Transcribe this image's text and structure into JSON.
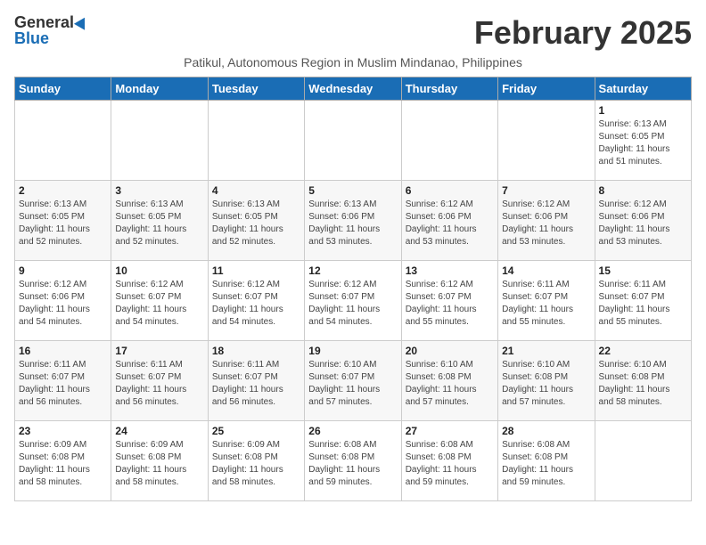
{
  "logo": {
    "general": "General",
    "blue": "Blue"
  },
  "title": "February 2025",
  "subtitle": "Patikul, Autonomous Region in Muslim Mindanao, Philippines",
  "days_of_week": [
    "Sunday",
    "Monday",
    "Tuesday",
    "Wednesday",
    "Thursday",
    "Friday",
    "Saturday"
  ],
  "weeks": [
    [
      {
        "day": "",
        "info": ""
      },
      {
        "day": "",
        "info": ""
      },
      {
        "day": "",
        "info": ""
      },
      {
        "day": "",
        "info": ""
      },
      {
        "day": "",
        "info": ""
      },
      {
        "day": "",
        "info": ""
      },
      {
        "day": "1",
        "info": "Sunrise: 6:13 AM\nSunset: 6:05 PM\nDaylight: 11 hours\nand 51 minutes."
      }
    ],
    [
      {
        "day": "2",
        "info": "Sunrise: 6:13 AM\nSunset: 6:05 PM\nDaylight: 11 hours\nand 52 minutes."
      },
      {
        "day": "3",
        "info": "Sunrise: 6:13 AM\nSunset: 6:05 PM\nDaylight: 11 hours\nand 52 minutes."
      },
      {
        "day": "4",
        "info": "Sunrise: 6:13 AM\nSunset: 6:05 PM\nDaylight: 11 hours\nand 52 minutes."
      },
      {
        "day": "5",
        "info": "Sunrise: 6:13 AM\nSunset: 6:06 PM\nDaylight: 11 hours\nand 53 minutes."
      },
      {
        "day": "6",
        "info": "Sunrise: 6:12 AM\nSunset: 6:06 PM\nDaylight: 11 hours\nand 53 minutes."
      },
      {
        "day": "7",
        "info": "Sunrise: 6:12 AM\nSunset: 6:06 PM\nDaylight: 11 hours\nand 53 minutes."
      },
      {
        "day": "8",
        "info": "Sunrise: 6:12 AM\nSunset: 6:06 PM\nDaylight: 11 hours\nand 53 minutes."
      }
    ],
    [
      {
        "day": "9",
        "info": "Sunrise: 6:12 AM\nSunset: 6:06 PM\nDaylight: 11 hours\nand 54 minutes."
      },
      {
        "day": "10",
        "info": "Sunrise: 6:12 AM\nSunset: 6:07 PM\nDaylight: 11 hours\nand 54 minutes."
      },
      {
        "day": "11",
        "info": "Sunrise: 6:12 AM\nSunset: 6:07 PM\nDaylight: 11 hours\nand 54 minutes."
      },
      {
        "day": "12",
        "info": "Sunrise: 6:12 AM\nSunset: 6:07 PM\nDaylight: 11 hours\nand 54 minutes."
      },
      {
        "day": "13",
        "info": "Sunrise: 6:12 AM\nSunset: 6:07 PM\nDaylight: 11 hours\nand 55 minutes."
      },
      {
        "day": "14",
        "info": "Sunrise: 6:11 AM\nSunset: 6:07 PM\nDaylight: 11 hours\nand 55 minutes."
      },
      {
        "day": "15",
        "info": "Sunrise: 6:11 AM\nSunset: 6:07 PM\nDaylight: 11 hours\nand 55 minutes."
      }
    ],
    [
      {
        "day": "16",
        "info": "Sunrise: 6:11 AM\nSunset: 6:07 PM\nDaylight: 11 hours\nand 56 minutes."
      },
      {
        "day": "17",
        "info": "Sunrise: 6:11 AM\nSunset: 6:07 PM\nDaylight: 11 hours\nand 56 minutes."
      },
      {
        "day": "18",
        "info": "Sunrise: 6:11 AM\nSunset: 6:07 PM\nDaylight: 11 hours\nand 56 minutes."
      },
      {
        "day": "19",
        "info": "Sunrise: 6:10 AM\nSunset: 6:07 PM\nDaylight: 11 hours\nand 57 minutes."
      },
      {
        "day": "20",
        "info": "Sunrise: 6:10 AM\nSunset: 6:08 PM\nDaylight: 11 hours\nand 57 minutes."
      },
      {
        "day": "21",
        "info": "Sunrise: 6:10 AM\nSunset: 6:08 PM\nDaylight: 11 hours\nand 57 minutes."
      },
      {
        "day": "22",
        "info": "Sunrise: 6:10 AM\nSunset: 6:08 PM\nDaylight: 11 hours\nand 58 minutes."
      }
    ],
    [
      {
        "day": "23",
        "info": "Sunrise: 6:09 AM\nSunset: 6:08 PM\nDaylight: 11 hours\nand 58 minutes."
      },
      {
        "day": "24",
        "info": "Sunrise: 6:09 AM\nSunset: 6:08 PM\nDaylight: 11 hours\nand 58 minutes."
      },
      {
        "day": "25",
        "info": "Sunrise: 6:09 AM\nSunset: 6:08 PM\nDaylight: 11 hours\nand 58 minutes."
      },
      {
        "day": "26",
        "info": "Sunrise: 6:08 AM\nSunset: 6:08 PM\nDaylight: 11 hours\nand 59 minutes."
      },
      {
        "day": "27",
        "info": "Sunrise: 6:08 AM\nSunset: 6:08 PM\nDaylight: 11 hours\nand 59 minutes."
      },
      {
        "day": "28",
        "info": "Sunrise: 6:08 AM\nSunset: 6:08 PM\nDaylight: 11 hours\nand 59 minutes."
      },
      {
        "day": "",
        "info": ""
      }
    ]
  ]
}
